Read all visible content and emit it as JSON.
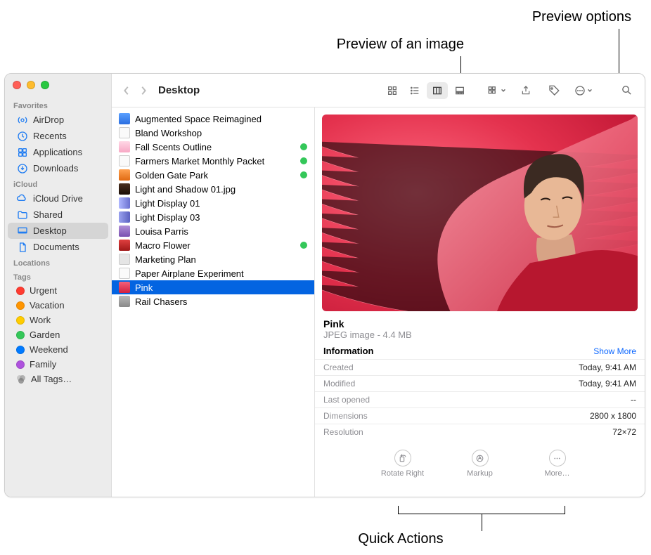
{
  "callouts": {
    "preview_image": "Preview of an image",
    "preview_options": "Preview options",
    "quick_actions": "Quick Actions"
  },
  "traffic": {
    "close": "#ff5f57",
    "min": "#febc2e",
    "max": "#28c840"
  },
  "sidebar": {
    "sections": [
      "Favorites",
      "iCloud",
      "Locations",
      "Tags"
    ],
    "favorites": [
      {
        "name": "AirDrop"
      },
      {
        "name": "Recents"
      },
      {
        "name": "Applications"
      },
      {
        "name": "Downloads"
      }
    ],
    "icloud": [
      {
        "name": "iCloud Drive"
      },
      {
        "name": "Shared"
      },
      {
        "name": "Desktop",
        "selected": true
      },
      {
        "name": "Documents"
      }
    ],
    "tags": [
      {
        "name": "Urgent",
        "color": "#ff3b30"
      },
      {
        "name": "Vacation",
        "color": "#ff9500"
      },
      {
        "name": "Work",
        "color": "#ffcc00"
      },
      {
        "name": "Garden",
        "color": "#34c759"
      },
      {
        "name": "Weekend",
        "color": "#007aff"
      },
      {
        "name": "Family",
        "color": "#af52de"
      },
      {
        "name": "All Tags…",
        "color": "multi"
      }
    ]
  },
  "toolbar": {
    "title": "Desktop"
  },
  "files": [
    {
      "name": "Augmented Space Reimagined",
      "icon": "doc-blue"
    },
    {
      "name": "Bland Workshop",
      "icon": "doc-paper"
    },
    {
      "name": "Fall Scents Outline",
      "icon": "doc-pink",
      "tag": "#34c759"
    },
    {
      "name": "Farmers Market Monthly Packet",
      "icon": "doc-paper",
      "tag": "#34c759"
    },
    {
      "name": "Golden Gate Park",
      "icon": "img-orange",
      "tag": "#34c759"
    },
    {
      "name": "Light and Shadow 01.jpg",
      "icon": "img-dark"
    },
    {
      "name": "Light Display 01",
      "icon": "img-fan1"
    },
    {
      "name": "Light Display 03",
      "icon": "img-fan2"
    },
    {
      "name": "Louisa Parris",
      "icon": "img-purple"
    },
    {
      "name": "Macro Flower",
      "icon": "img-red",
      "tag": "#34c759"
    },
    {
      "name": "Marketing Plan",
      "icon": "doc-gray"
    },
    {
      "name": "Paper Airplane Experiment",
      "icon": "doc-paper"
    },
    {
      "name": "Pink",
      "icon": "img-pink",
      "selected": true
    },
    {
      "name": "Rail Chasers",
      "icon": "img-gray"
    }
  ],
  "preview": {
    "title": "Pink",
    "subtitle": "JPEG image - 4.4 MB",
    "info_label": "Information",
    "show_more": "Show More",
    "rows": [
      {
        "k": "Created",
        "v": "Today, 9:41 AM"
      },
      {
        "k": "Modified",
        "v": "Today, 9:41 AM"
      },
      {
        "k": "Last opened",
        "v": "--"
      },
      {
        "k": "Dimensions",
        "v": "2800 x 1800"
      },
      {
        "k": "Resolution",
        "v": "72×72"
      }
    ],
    "quick_actions": [
      {
        "label": "Rotate Right"
      },
      {
        "label": "Markup"
      },
      {
        "label": "More…"
      }
    ]
  }
}
